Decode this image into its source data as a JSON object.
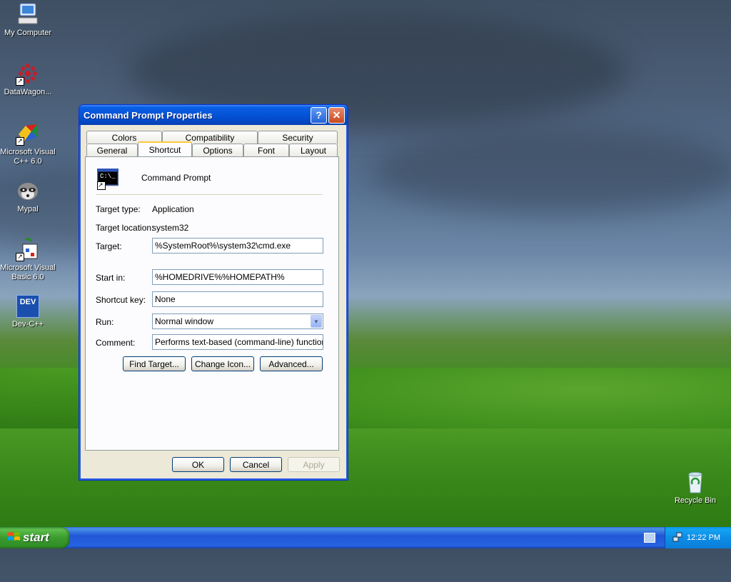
{
  "desktop": {
    "icons": [
      {
        "label": "My Computer"
      },
      {
        "label": "DataWagon..."
      },
      {
        "label": "Microsoft Visual C++ 6.0"
      },
      {
        "label": "Mypal"
      },
      {
        "label": "Microsoft Visual Basic 6.0"
      },
      {
        "label": "Dev-C++"
      },
      {
        "label": "Recycle Bin"
      }
    ],
    "dev_icon_text": "DEV"
  },
  "dialog": {
    "title": "Command Prompt Properties",
    "help_glyph": "?",
    "close_glyph": "✕",
    "tabs_back": [
      "Colors",
      "Compatibility",
      "Security"
    ],
    "tabs_front": [
      "General",
      "Shortcut",
      "Options",
      "Font",
      "Layout"
    ],
    "active_tab": "Shortcut",
    "icon_text": "C:\\_",
    "shortcut_name": "Command Prompt",
    "target_type_label": "Target type:",
    "target_type_value": "Application",
    "target_location_label": "Target location:",
    "target_location_value": "system32",
    "target_label": "Target:",
    "target_value": "%SystemRoot%\\system32\\cmd.exe",
    "start_in_label": "Start in:",
    "start_in_value": "%HOMEDRIVE%%HOMEPATH%",
    "shortcut_key_label": "Shortcut key:",
    "shortcut_key_value": "None",
    "run_label": "Run:",
    "run_value": "Normal window",
    "comment_label": "Comment:",
    "comment_value": "Performs text-based (command-line) functions.",
    "find_target": "Find Target...",
    "change_icon": "Change Icon...",
    "advanced": "Advanced...",
    "ok": "OK",
    "cancel": "Cancel",
    "apply": "Apply"
  },
  "taskbar": {
    "start_label": "start",
    "clock": "12:22 PM"
  }
}
